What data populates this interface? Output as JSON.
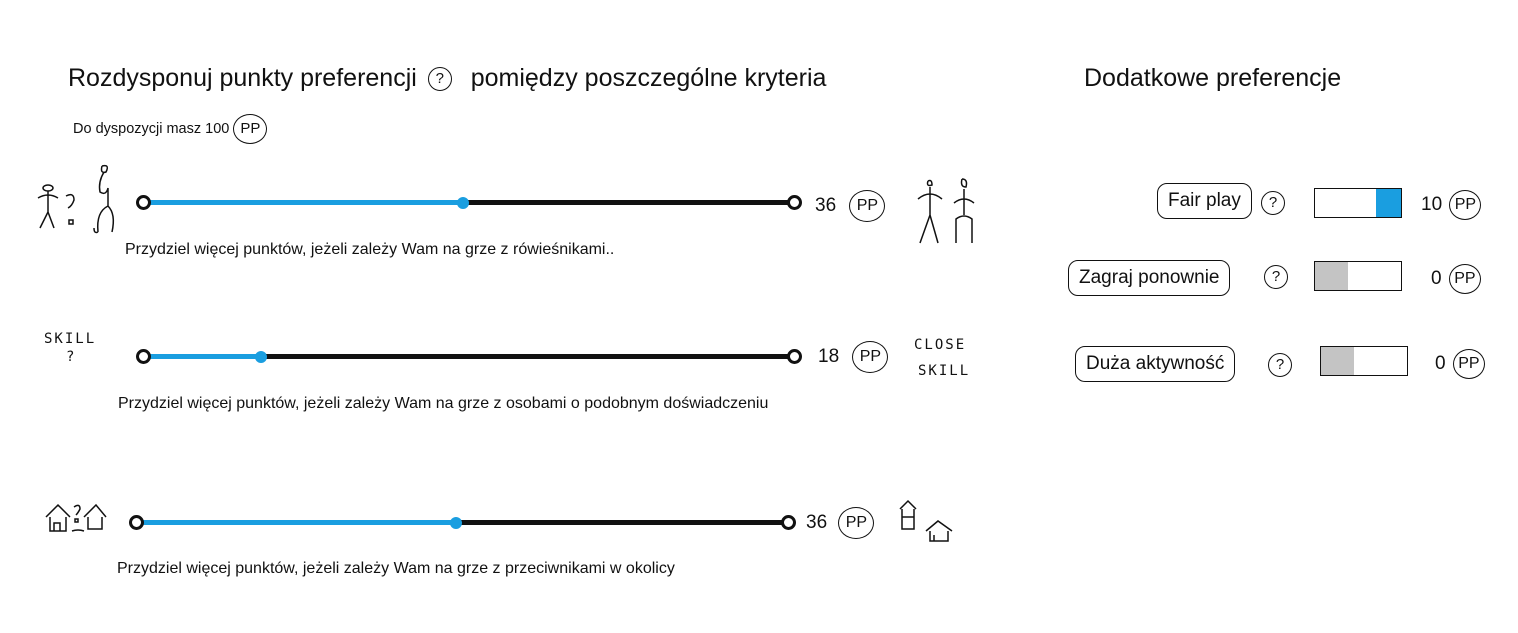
{
  "header": {
    "title_part1": "Rozdysponuj punkty preferencji",
    "title_help": "?",
    "title_part2": "pomiędzy poszczególne kryteria",
    "budget_text": "Do dyspozycji masz 100",
    "pp_unit": "PP"
  },
  "sliders": [
    {
      "value": 36,
      "fraction": 0.49,
      "description": "Przydziel więcej punktów, jeżeli zależy Wam na grze z rówieśnikami..",
      "left_icon": "age-question-figures-icon",
      "right_icon": "same-age-figures-icon"
    },
    {
      "value": 18,
      "fraction": 0.18,
      "description": "Przydziel więcej punktów, jeżeli zależy Wam na grze z osobami o podobnym doświadczeniu",
      "left_label_line1": "SKILL",
      "left_label_line2": "?",
      "right_label_line1": "CLOSE",
      "right_label_line2": "SKILL"
    },
    {
      "value": 36,
      "fraction": 0.49,
      "description": "Przydziel więcej punktów, jeżeli zależy Wam na grze z przeciwnikami w okolicy",
      "left_icon": "houses-question-icon",
      "right_icon": "nearby-houses-icon"
    }
  ],
  "additional": {
    "title": "Dodatkowe preferencje",
    "items": [
      {
        "label": "Fair play",
        "help": "?",
        "value": 10,
        "fill_fraction": 0.3,
        "active": true
      },
      {
        "label": "Zagraj ponownie",
        "help": "?",
        "value": 0,
        "fill_fraction": 0.4,
        "active": false
      },
      {
        "label": "Duża aktywność",
        "help": "?",
        "value": 0,
        "fill_fraction": 0.4,
        "active": false
      }
    ]
  },
  "colors": {
    "accent": "#1a9ee0",
    "track": "#111111",
    "toggle_inactive": "#c4c4c4"
  }
}
